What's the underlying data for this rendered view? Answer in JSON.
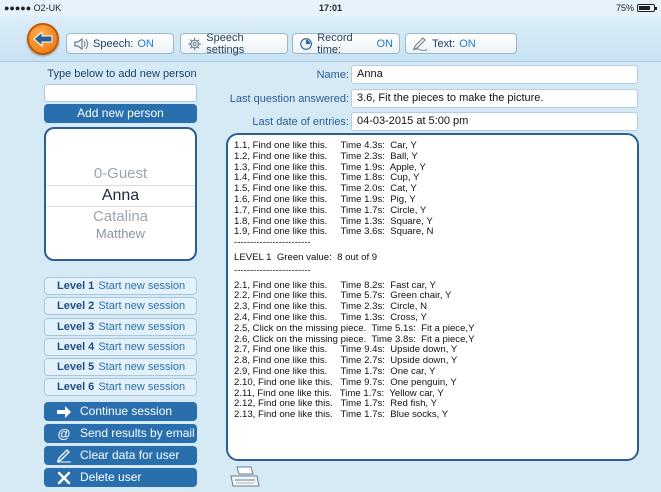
{
  "status_bar": {
    "carrier": "●●●●● O2-UK",
    "time": "17:01",
    "battery": "75%"
  },
  "toolbar": {
    "speech_label": "Speech:",
    "speech_value": "ON",
    "speech_settings_label": "Speech settings",
    "record_time_label": "Record time:",
    "record_time_value": "ON",
    "text_label": "Text:",
    "text_value": "ON"
  },
  "sidebar": {
    "hint": "Type below to add new person",
    "new_person_value": "",
    "add_button": "Add new person",
    "people": [
      "0-Guest",
      "Anna",
      "Catalina",
      "Matthew"
    ],
    "selected_person": "Anna",
    "levels": [
      {
        "level": "Level 1",
        "action": "Start new session"
      },
      {
        "level": "Level 2",
        "action": "Start new session"
      },
      {
        "level": "Level 3",
        "action": "Start new session"
      },
      {
        "level": "Level 4",
        "action": "Start new session"
      },
      {
        "level": "Level 5",
        "action": "Start new session"
      },
      {
        "level": "Level 6",
        "action": "Start new session"
      }
    ],
    "actions": {
      "continue": "Continue session",
      "email": "Send results by email",
      "clear": "Clear data for user",
      "delete": "Delete user"
    }
  },
  "details": {
    "name_label": "Name:",
    "name_value": "Anna",
    "last_question_label": "Last question answered:",
    "last_question_value": "3.6, Fit the pieces to make the picture.",
    "last_date_label": "Last date of entries:",
    "last_date_value": "04-03-2015 at 5:00 pm"
  },
  "history": [
    "1.1, Find one like this.     Time 4.3s:  Car, Y",
    "1.2, Find one like this.     Time 2.3s:  Ball, Y",
    "1.3, Find one like this.     Time 1.9s:  Apple, Y",
    "1.4, Find one like this.     Time 1.8s:  Cup, Y",
    "1.5, Find one like this.     Time 2.0s:  Cat, Y",
    "1.6, Find one like this.     Time 1.9s:  Pig, Y",
    "1.7, Find one like this.     Time 1.7s:  Circle, Y",
    "1.8, Find one like this.     Time 1.3s:  Square, Y",
    "1.9, Find one like this.     Time 3.6s:  Square, N",
    "------------------------",
    "LEVEL 1  Green value:  8 out of 9",
    "------------------------",
    "2.1, Find one like this.     Time 8.2s:  Fast car, Y",
    "2.2, Find one like this.     Time 5.7s:  Green chair, Y",
    "2.3, Find one like this.     Time 2.3s:  Circle, N",
    "2.4, Find one like this.     Time 1.3s:  Cross, Y",
    "2.5, Click on the missing piece.  Time 5.1s:  Fit a piece,Y",
    "2.6, Click on the missing piece.  Time 3.8s:  Fit a piece,Y",
    "2.7, Find one like this.     Time 9.4s:  Upside down, Y",
    "2.8, Find one like this.     Time 2.7s:  Upside down, Y",
    "2.9, Find one like this.     Time 1.7s:  One car, Y",
    "2.10, Find one like this.   Time 9.7s:  One penguin, Y",
    "2.11, Find one like this.   Time 1.7s:  Yellow car, Y",
    "2.12, Find one like this.   Time 1.7s:  Red fish, Y",
    "2.13, Find one like this.   Time 1.7s:  Blue socks, Y"
  ],
  "colors": {
    "accent": "#2a6fad",
    "on_value": "#1d7ec0",
    "back_button": "#f28a1e",
    "background": "#d6eaf6"
  }
}
